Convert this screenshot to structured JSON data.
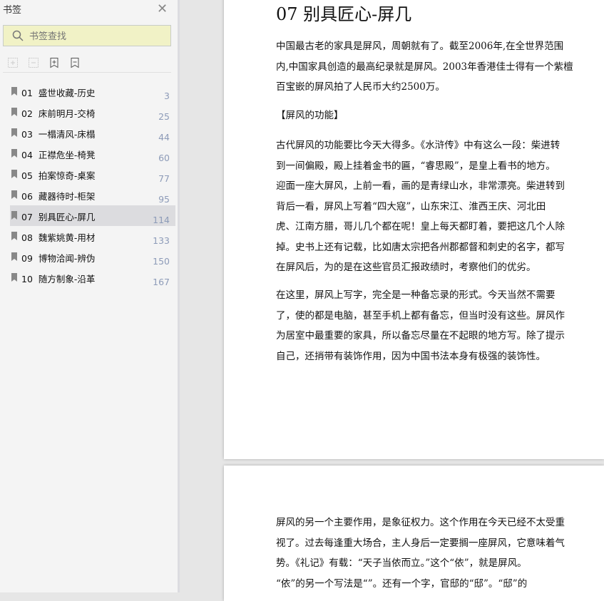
{
  "sidebar": {
    "title": "书签",
    "search_placeholder": "书签查找",
    "items": [
      {
        "num": "01",
        "label": "盛世收藏-历史",
        "page": "3"
      },
      {
        "num": "02",
        "label": "床前明月-交椅",
        "page": "25"
      },
      {
        "num": "03",
        "label": "一榻清风-床榻",
        "page": "44"
      },
      {
        "num": "04",
        "label": "正襟危坐-椅凳",
        "page": "60"
      },
      {
        "num": "05",
        "label": "拍案惊奇-桌案",
        "page": "77"
      },
      {
        "num": "06",
        "label": "藏器待时-柜架",
        "page": "95"
      },
      {
        "num": "07",
        "label": "别具匠心-屏几",
        "page": "114"
      },
      {
        "num": "08",
        "label": "魏紫姚黄-用材",
        "page": "133"
      },
      {
        "num": "09",
        "label": "博物洽闻-辨伪",
        "page": "150"
      },
      {
        "num": "10",
        "label": "随方制象-沿革",
        "page": "167"
      }
    ],
    "selected_index": 6
  },
  "page1": {
    "title": "07 别具匠心-屏几",
    "p1": [
      "中国最古老的家具是屏风，周朝就有了。截至2006年,在全世界范围",
      "内,中国家具创造的最高纪录就是屏风。2003年香港佳士得有一个紫檀",
      "百宝嵌的屏风拍了人民币大约2500万。"
    ],
    "heading": "【屏风的功能】",
    "p2": [
      "古代屏风的功能要比今天大得多。《水浒传》中有这么一段：柴进转",
      "到一间偏殿，殿上挂着金书的匾，“睿思殿”，是皇上看书的地方。",
      "迎面一座大屏风，上前一看，画的是青绿山水，非常漂亮。柴进转到",
      "背后一看，屏风上写着“四大寇”，山东宋江、淮西王庆、河北田",
      "虎、江南方腊，哥儿几个都在呢！皇上每天都盯着，要把这几个人除",
      "掉。史书上还有记载，比如唐太宗把各州郡都督和刺史的名字，都写",
      "在屏风后，为的是在这些官员汇报政绩时，考察他们的优劣。"
    ],
    "p3": [
      "在这里，屏风上写字，完全是一种备忘录的形式。今天当然不需要",
      "了，使的都是电脑，甚至手机上都有备忘，但当时没有这些。屏风作",
      "为居室中最重要的家具，所以备忘尽量在不起眼的地方写。除了提示",
      "自己，还捎带有装饰作用，因为中国书法本身有极强的装饰性。"
    ]
  },
  "page2": {
    "p1": [
      "屏风的另一个主要作用，是象征权力。这个作用在今天已经不太受重",
      "视了。过去每逢重大场合，主人身后一定要搁一座屏风，它意味着气",
      "势。《礼记》有载：“天子当依而立。”这个“依”，就是屏风。",
      "“依”的另一个写法是“”。还有一个字，官邸的“邸”。“邸”的"
    ]
  }
}
